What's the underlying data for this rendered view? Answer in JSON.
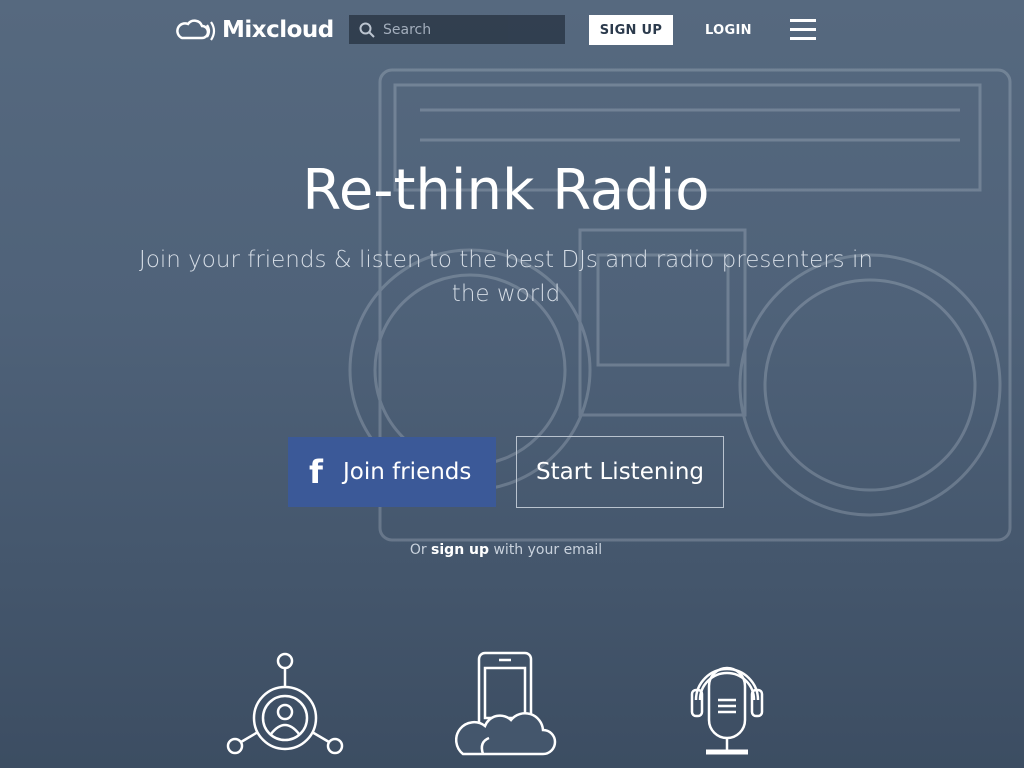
{
  "header": {
    "logo_text": "Mixcloud",
    "search_placeholder": "Search",
    "signup_label": "SIGN UP",
    "login_label": "LOGIN"
  },
  "hero": {
    "title": "Re-think Radio",
    "subtitle": "Join your friends & listen to the best DJs and radio presenters in the world"
  },
  "cta": {
    "facebook_label": "Join friends",
    "listen_label": "Start Listening",
    "email_prefix": "Or ",
    "email_link": "sign up",
    "email_suffix": " with your email"
  },
  "features": {
    "icons": [
      "network-user-icon",
      "phone-cloud-icon",
      "microphone-headphones-icon"
    ]
  },
  "colors": {
    "background": "#4f6279",
    "facebook": "#3b5998",
    "search_bg": "#2f3c4c"
  }
}
